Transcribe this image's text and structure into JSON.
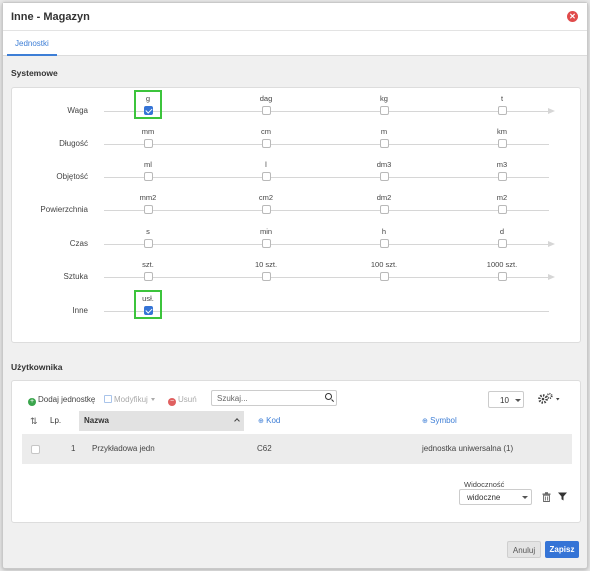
{
  "window": {
    "title": "Inne - Magazyn",
    "close_glyph": "✕"
  },
  "tabs": [
    {
      "label": "Jednostki",
      "active": true
    }
  ],
  "systemowe": {
    "title": "Systemowe",
    "rows": [
      {
        "label": "Waga",
        "units": [
          {
            "name": "g",
            "checked": true
          },
          {
            "name": "dag",
            "checked": false
          },
          {
            "name": "kg",
            "checked": false
          },
          {
            "name": "t",
            "checked": false
          }
        ],
        "arrow": true
      },
      {
        "label": "Długość",
        "units": [
          {
            "name": "mm",
            "checked": false
          },
          {
            "name": "cm",
            "checked": false
          },
          {
            "name": "m",
            "checked": false
          },
          {
            "name": "km",
            "checked": false
          }
        ],
        "arrow": false
      },
      {
        "label": "Objętość",
        "units": [
          {
            "name": "ml",
            "checked": false
          },
          {
            "name": "l",
            "checked": false
          },
          {
            "name": "dm3",
            "checked": false
          },
          {
            "name": "m3",
            "checked": false
          }
        ],
        "arrow": false
      },
      {
        "label": "Powierzchnia",
        "units": [
          {
            "name": "mm2",
            "checked": false
          },
          {
            "name": "cm2",
            "checked": false
          },
          {
            "name": "dm2",
            "checked": false
          },
          {
            "name": "m2",
            "checked": false
          }
        ],
        "arrow": false
      },
      {
        "label": "Czas",
        "units": [
          {
            "name": "s",
            "checked": false
          },
          {
            "name": "min",
            "checked": false
          },
          {
            "name": "h",
            "checked": false
          },
          {
            "name": "d",
            "checked": false
          }
        ],
        "arrow": true
      },
      {
        "label": "Sztuka",
        "units": [
          {
            "name": "szt.",
            "checked": false
          },
          {
            "name": "10 szt.",
            "checked": false
          },
          {
            "name": "100 szt.",
            "checked": false
          },
          {
            "name": "1000 szt.",
            "checked": false
          }
        ],
        "arrow": true
      },
      {
        "label": "Inne",
        "units": [
          {
            "name": "usł.",
            "checked": true
          }
        ],
        "arrow": false
      }
    ]
  },
  "uzytkownika": {
    "title": "Użytkownika",
    "toolbar": {
      "add_label": "Dodaj jednostkę",
      "modify_label": "Modyfikuj",
      "delete_label": "Usuń"
    },
    "search": {
      "placeholder": "Szukaj..."
    },
    "page_size": "10",
    "columns": {
      "lp": "Lp.",
      "nazwa": "Nazwa",
      "kod": "Kod",
      "symbol": "Symbol"
    },
    "rows": [
      {
        "lp": "1",
        "nazwa": "Przykładowa jedn",
        "kod": "C62",
        "symbol": "jednostka uniwersalna (1)"
      }
    ],
    "visibility": {
      "label": "Widoczność",
      "value": "widoczne"
    }
  },
  "footer": {
    "cancel_label": "Anuluj",
    "save_label": "Zapisz"
  },
  "colors": {
    "accent": "#3d7ed6",
    "primary_button": "#3574d6",
    "highlight": "#3cc43c",
    "close": "#e04b4b",
    "add_icon": "#3aa54c",
    "delete_icon": "#e06060"
  }
}
